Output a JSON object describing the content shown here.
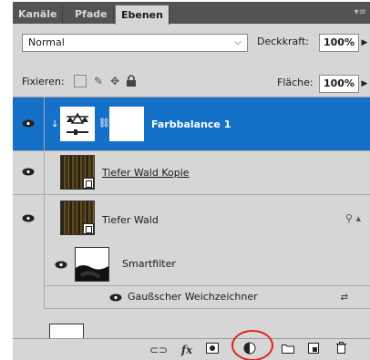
{
  "tabs": [
    {
      "label": "Kanäle"
    },
    {
      "label": "Pfade"
    },
    {
      "label": "Ebenen"
    }
  ],
  "panel_menu_icon": "menu-icon",
  "blend_mode": {
    "value": "Normal"
  },
  "opacity": {
    "label": "Deckkraft:",
    "value": "100%"
  },
  "lock": {
    "label": "Fixieren:",
    "icons": [
      "lock-transparent-icon",
      "lock-paint-icon",
      "lock-move-icon",
      "lock-all-icon"
    ]
  },
  "fill": {
    "label": "Fläche:",
    "value": "100%"
  },
  "layers": [
    {
      "name": "Farbbalance 1",
      "selected": true,
      "type": "adjustment"
    },
    {
      "name": "Tiefer Wald Kopie",
      "selected": false,
      "type": "smart-object"
    },
    {
      "name": "Tiefer Wald",
      "selected": false,
      "type": "smart-object"
    }
  ],
  "smartfilter": {
    "label": "Smartfilter"
  },
  "filter": {
    "label": "Gaußscher Weichzeichner"
  },
  "toolbar": {
    "fx_label": "fx",
    "icons": [
      "link-layers-icon",
      "fx-icon",
      "add-mask-icon",
      "new-adjustment-layer-icon",
      "new-group-icon",
      "new-layer-icon",
      "trash-icon"
    ]
  },
  "colors": {
    "selected": "#1570c8",
    "panel": "#d6d6d6",
    "tabbar": "#535353",
    "highlight": "#e0231c"
  }
}
